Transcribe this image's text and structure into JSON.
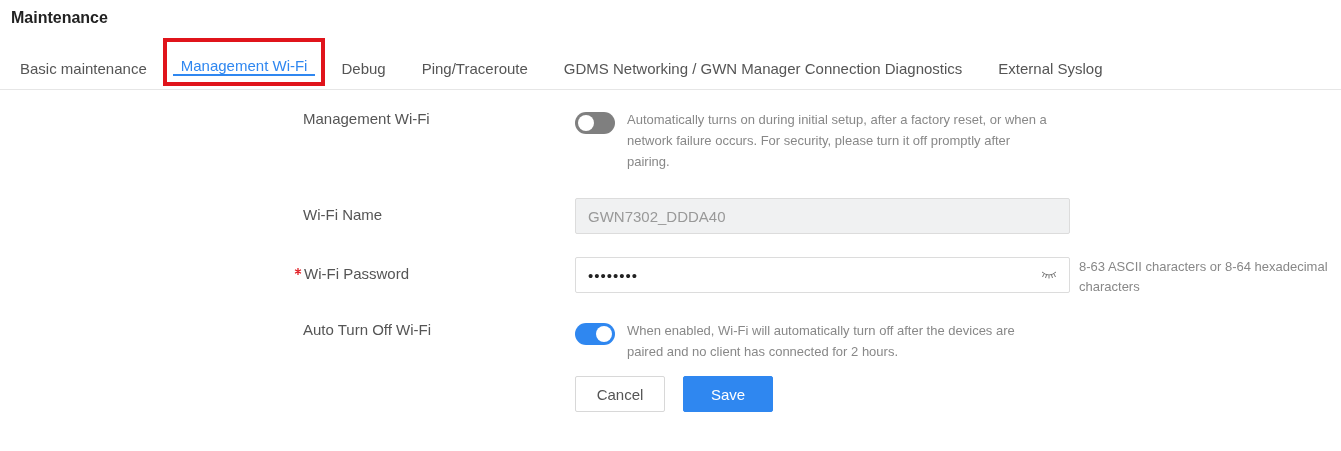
{
  "page_title": "Maintenance",
  "tabs": [
    {
      "label": "Basic maintenance",
      "selected": false,
      "highlighted": false
    },
    {
      "label": "Management Wi-Fi",
      "selected": true,
      "highlighted": true
    },
    {
      "label": "Debug",
      "selected": false,
      "highlighted": false
    },
    {
      "label": "Ping/Traceroute",
      "selected": false,
      "highlighted": false
    },
    {
      "label": "GDMS Networking / GWN Manager Connection Diagnostics",
      "selected": false,
      "highlighted": false
    },
    {
      "label": "External Syslog",
      "selected": false,
      "highlighted": false
    }
  ],
  "form": [
    {
      "kind": "toggle",
      "label": "Management Wi-Fi",
      "required": false,
      "on": false,
      "help": "Automatically turns on during initial setup, after a factory reset, or when a network failure occurs. For security, please turn it off promptly after pairing."
    },
    {
      "kind": "text",
      "label": "Wi-Fi Name",
      "required": false,
      "disabled": true,
      "value": "GWN7302_DDDA40"
    },
    {
      "kind": "password",
      "label": "Wi-Fi Password",
      "required": true,
      "value": "••••••••",
      "hint": "8-63 ASCII characters or 8-64 hexadecimal characters"
    },
    {
      "kind": "toggle",
      "label": "Auto Turn Off Wi-Fi",
      "required": false,
      "on": true,
      "help": "When enabled, Wi-Fi will automatically turn off after the devices are paired and no client has connected for 2 hours."
    }
  ],
  "buttons": [
    {
      "label": "Cancel",
      "kind": "secondary"
    },
    {
      "label": "Save",
      "kind": "primary"
    }
  ]
}
